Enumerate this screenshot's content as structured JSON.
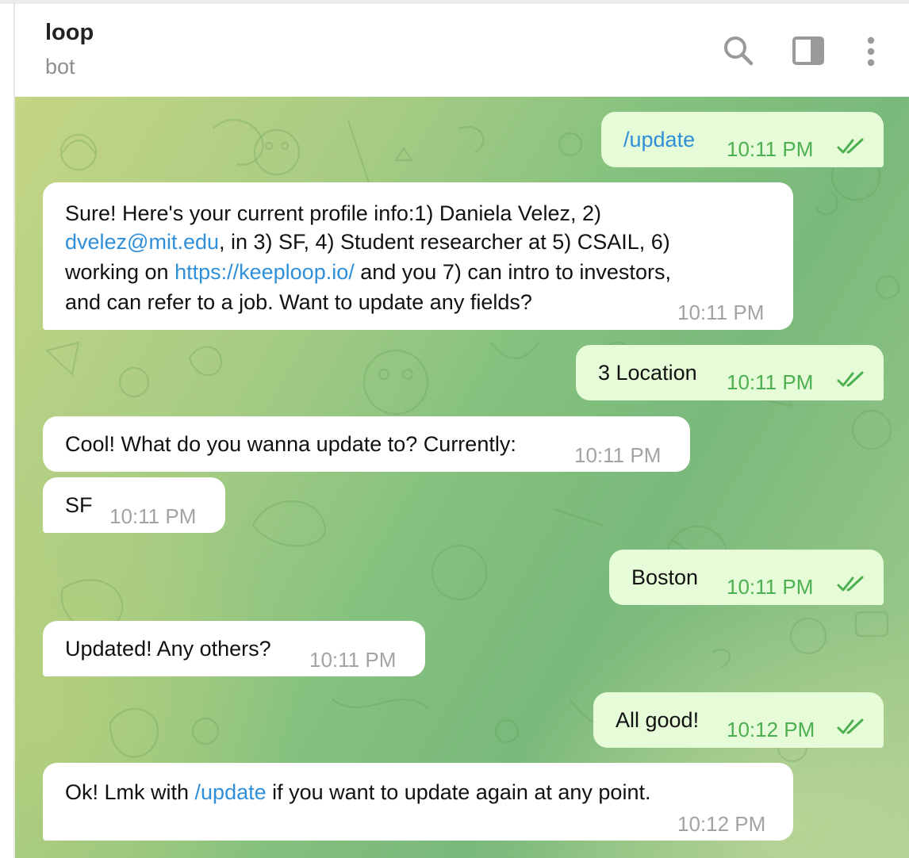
{
  "header": {
    "title": "loop",
    "subtitle": "bot",
    "icons": [
      "search-icon",
      "sidebar-toggle-icon",
      "more-vertical-icon"
    ]
  },
  "colors": {
    "incoming_bubble": "#ffffff",
    "outgoing_bubble": "#e6fcd8",
    "link": "#2f8fd8",
    "outgoing_time": "#4caf50",
    "incoming_time": "#a3a3a3"
  },
  "messages": [
    {
      "direction": "out",
      "text": "/update",
      "time": "10:11 PM",
      "read": true
    },
    {
      "direction": "in",
      "lines": [
        [
          "Sure! Here's your current profile info:1) Daniela Velez, 2)"
        ],
        [
          "dvelez@mit.edu",
          ", in 3)  SF, 4) Student researcher at 5) CSAIL, 6)"
        ],
        [
          "working on ",
          "https://keeploop.io/",
          " and you 7) can intro to investors,"
        ],
        [
          "and can refer to a job. Want to update any fields?"
        ]
      ],
      "time": "10:11 PM"
    },
    {
      "direction": "out",
      "text": "3 Location",
      "time": "10:11 PM",
      "read": true
    },
    {
      "direction": "in",
      "text": "Cool! What do you wanna update to? Currently:",
      "time": "10:11 PM"
    },
    {
      "direction": "in",
      "text": "SF",
      "time": "10:11 PM"
    },
    {
      "direction": "out",
      "text": "Boston",
      "time": "10:11 PM",
      "read": true
    },
    {
      "direction": "in",
      "text": "Updated! Any others?",
      "time": "10:11 PM"
    },
    {
      "direction": "out",
      "text": "All good!",
      "time": "10:12 PM",
      "read": true
    },
    {
      "direction": "in",
      "parts": [
        "Ok! Lmk with ",
        "/update",
        " if you want to update again at any point."
      ],
      "time": "10:12 PM"
    }
  ]
}
